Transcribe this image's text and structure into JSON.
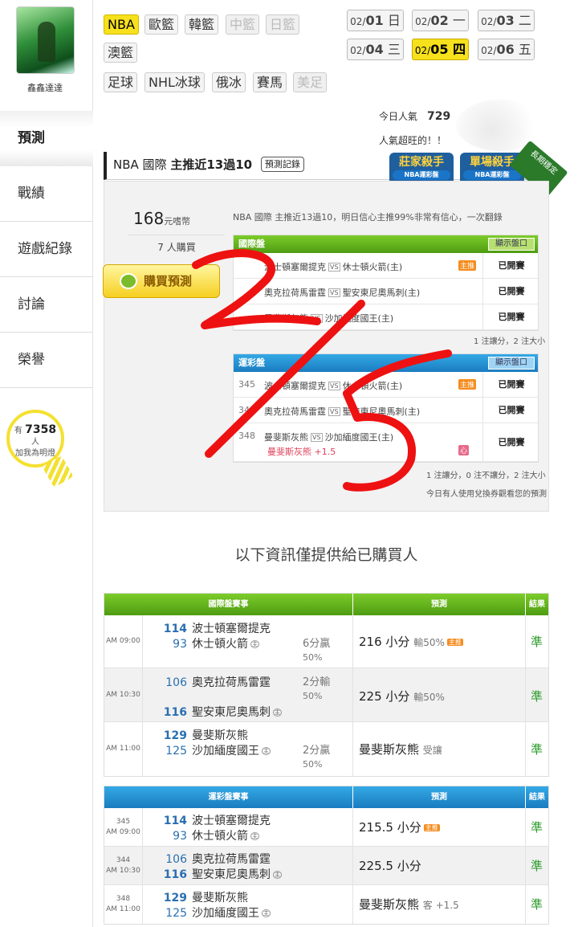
{
  "user": {
    "name": "鑫鑫達達"
  },
  "nav": [
    "預測",
    "戰績",
    "遊戲紀錄",
    "討論",
    "榮譽"
  ],
  "lamp": {
    "prefix": "有",
    "count": "7358",
    "unit": "人",
    "caption": "加我為明燈"
  },
  "sport_tags": [
    {
      "label": "NBA",
      "state": "active"
    },
    {
      "label": "歐籃",
      "state": "normal"
    },
    {
      "label": "韓籃",
      "state": "normal"
    },
    {
      "label": "中籃",
      "state": "disabled"
    },
    {
      "label": "日籃",
      "state": "disabled"
    },
    {
      "label": "澳籃",
      "state": "normal"
    },
    {
      "label": "足球",
      "state": "normal"
    },
    {
      "label": "NHL冰球",
      "state": "normal"
    },
    {
      "label": "俄冰",
      "state": "normal"
    },
    {
      "label": "賽馬",
      "state": "normal"
    },
    {
      "label": "美足",
      "state": "disabled"
    }
  ],
  "dates": [
    {
      "md": "02/",
      "d": "01",
      "w": "日"
    },
    {
      "md": "02/",
      "d": "02",
      "w": "一"
    },
    {
      "md": "02/",
      "d": "03",
      "w": "二"
    },
    {
      "md": "02/",
      "d": "04",
      "w": "三"
    },
    {
      "md": "02/",
      "d": "05",
      "w": "四"
    },
    {
      "md": "02/",
      "d": "06",
      "w": "五"
    }
  ],
  "popularity": {
    "label": "今日人氣",
    "value": "729",
    "slogan": "人氣超旺的！！"
  },
  "title": {
    "league": "NBA 國際",
    "headline": "主推近13過10",
    "record_btn": "預測記錄"
  },
  "badges": [
    {
      "title": "莊家殺手",
      "sub": "NBA運彩盤"
    },
    {
      "title": "單場殺手",
      "sub": "NBA運彩盤"
    }
  ],
  "ribbon": "長期穩定",
  "card": {
    "price": "168",
    "price_unit": "元嗜幣",
    "buyers": "7 人購買",
    "buy_btn": "購買預測",
    "buy_coin": "購",
    "info": "NBA 國際 主推近13過10，明日信心主推99%非常有信心，一次翻錄",
    "intl": {
      "title": "國際盤",
      "show_btn": "顯示盤口",
      "rows": [
        {
          "num": "",
          "away": "波士頓塞爾提克",
          "home": "休士頓火箭(主)",
          "icon": "主推",
          "status": "已開賽"
        },
        {
          "num": "",
          "away": "奧克拉荷馬雷霆",
          "home": "聖安東尼奧馬刺(主)",
          "icon": "",
          "status": "已開賽"
        },
        {
          "num": "",
          "away": "曼斐斯灰熊",
          "home": "沙加緬度國王(主)",
          "icon": "",
          "status": "已開賽"
        }
      ],
      "note": "1 注讓分，2 注大小"
    },
    "sports": {
      "title": "運彩盤",
      "show_btn": "顯示盤口",
      "rows": [
        {
          "num": "345",
          "away": "波士頓塞爾提克",
          "home": "休士頓火箭(主)",
          "icon": "主推",
          "status": "已開賽"
        },
        {
          "num": "344",
          "away": "奧克拉荷馬雷霆",
          "home": "聖安東尼奧馬刺(主)",
          "icon": "",
          "status": "已開賽"
        },
        {
          "num": "348",
          "away": "曼斐斯灰熊",
          "home": "沙加緬度國王(主)",
          "icon": "",
          "status": "已開賽",
          "extra": "曼斐斯灰熊 +1.5",
          "icon2": "心"
        }
      ],
      "note": "1 注讓分，0 注不讓分，2 注大小",
      "footnote": "今日有人使用兌換券觀看您的預測"
    }
  },
  "info_note": "以下資訊僅提供給已購買人",
  "intl_table": {
    "headers": [
      "國際盤賽事",
      "預測",
      "結果"
    ],
    "rows": [
      {
        "time": "AM 09:00",
        "num": "",
        "away_score": "114",
        "away": "波士頓塞爾提克",
        "home_score": "93",
        "home": "休士頓火箭",
        "home_mark": "主",
        "spread": "6分贏",
        "spread_pct": "50%",
        "pred": "216 小分",
        "pred_sub": "輸50%",
        "pred_icon": "主推",
        "result": "準"
      },
      {
        "time": "AM 10:30",
        "num": "",
        "away_score": "106",
        "away": "奧克拉荷馬雷霆",
        "home_score": "116",
        "home": "聖安東尼奧馬刺",
        "home_mark": "主",
        "spread": "2分輸",
        "spread_pct": "50%",
        "pred": "225 小分",
        "pred_sub": "輸50%",
        "pred_icon": "",
        "result": "準"
      },
      {
        "time": "AM 11:00",
        "num": "",
        "away_score": "129",
        "away": "曼斐斯灰熊",
        "home_score": "125",
        "home": "沙加緬度國王",
        "home_mark": "主",
        "spread": "2分贏",
        "spread_pct": "50%",
        "pred": "曼斐斯灰熊",
        "pred_sub": "受讓",
        "pred_icon": "",
        "result": "準"
      }
    ]
  },
  "sports_table": {
    "headers": [
      "運彩盤賽事",
      "預測",
      "結果"
    ],
    "rows": [
      {
        "time": "AM 09:00",
        "num": "345",
        "away_score": "114",
        "away": "波士頓塞爾提克",
        "home_score": "93",
        "home": "休士頓火箭",
        "home_mark": "主",
        "pred": "215.5 小分",
        "pred_sub": "",
        "pred_icon": "主推",
        "result": "準"
      },
      {
        "time": "AM 10:30",
        "num": "344",
        "away_score": "106",
        "away": "奧克拉荷馬雷霆",
        "home_score": "116",
        "home": "聖安東尼奧馬刺",
        "home_mark": "主",
        "pred": "225.5 小分",
        "pred_sub": "",
        "pred_icon": "",
        "result": "準"
      },
      {
        "time": "AM 11:00",
        "num": "348",
        "away_score": "129",
        "away": "曼斐斯灰熊",
        "home_score": "125",
        "home": "沙加緬度國王",
        "home_mark": "主",
        "pred": "曼斐斯灰熊",
        "pred_sub": "客 +1.5",
        "pred_icon": "",
        "result": "準"
      }
    ]
  },
  "colors": {
    "accent_yellow": "#f6e11c",
    "green_header": "#5aaa18",
    "blue_header": "#1f8fd4",
    "scribble": "#ee1111",
    "result_green": "#2a9a2a"
  }
}
